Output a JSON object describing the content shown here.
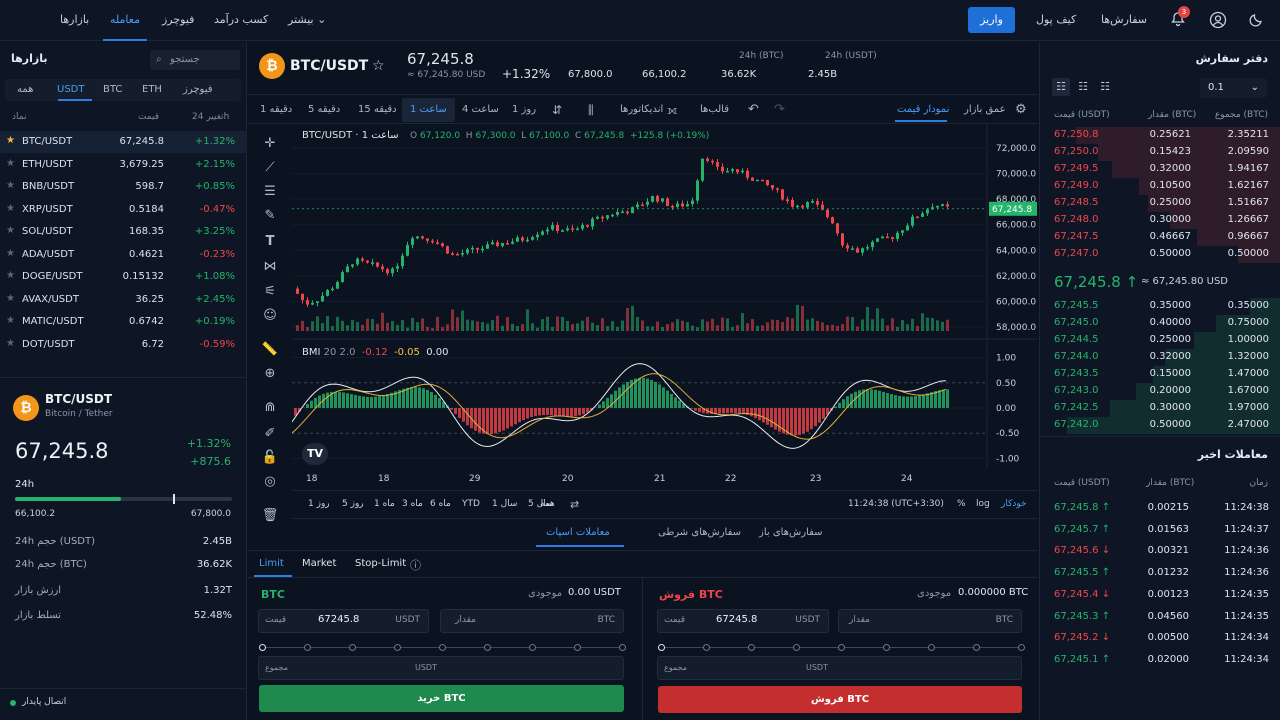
{
  "topbar": {
    "nav": [
      "بازارها",
      "فیوچرز",
      "معامله",
      "کسب درآمد",
      "بیشتر"
    ],
    "deposit": "واریز",
    "wallet": "کیف پول",
    "orders": "سفارش‌ها",
    "notif_count": "3"
  },
  "markets": {
    "title": "بازارها",
    "search_placeholder": "جستجو",
    "tabs": [
      "فیوچرز",
      "ETH",
      "BTC",
      "USDT",
      "همه"
    ],
    "col_name": "نماد",
    "col_price": "قیمت",
    "col_change": "تغییر 24h",
    "rows": [
      {
        "sym": "BTC/USDT",
        "price": "67,245.8",
        "change": "+1.32%",
        "up": true
      },
      {
        "sym": "ETH/USDT",
        "price": "3,679.25",
        "change": "+2.15%",
        "up": true
      },
      {
        "sym": "BNB/USDT",
        "price": "598.7",
        "change": "+0.85%",
        "up": true
      },
      {
        "sym": "XRP/USDT",
        "price": "0.5184",
        "change": "-0.47%",
        "up": false
      },
      {
        "sym": "SOL/USDT",
        "price": "168.35",
        "change": "+3.25%",
        "up": true
      },
      {
        "sym": "ADA/USDT",
        "price": "0.4621",
        "change": "-0.23%",
        "up": false
      },
      {
        "sym": "DOGE/USDT",
        "price": "0.15132",
        "change": "+1.08%",
        "up": true
      },
      {
        "sym": "AVAX/USDT",
        "price": "36.25",
        "change": "+2.45%",
        "up": true
      },
      {
        "sym": "MATIC/USDT",
        "price": "0.6742",
        "change": "+0.19%",
        "up": true
      },
      {
        "sym": "DOT/USDT",
        "price": "6.72",
        "change": "-0.59%",
        "up": false
      }
    ]
  },
  "summary": {
    "pair": "BTC/USDT",
    "sub": "Bitcoin / Tether",
    "price": "67,245.8",
    "chg_pct": "+1.32%",
    "chg_abs": "+875.6",
    "range_label": "24h",
    "low": "66,100.2",
    "high": "67,800.0",
    "range_fraction": 0.73,
    "stats": [
      {
        "k": "24h حجم (USDT)",
        "v": "2.45B"
      },
      {
        "k": "24h حجم (BTC)",
        "v": "36.62K"
      },
      {
        "k": "ارزش بازار",
        "v": "1.32T"
      },
      {
        "k": "تسلط بازار",
        "v": "52.48%"
      }
    ],
    "connection": "اتصال پایدار"
  },
  "header": {
    "pair": "BTC/USDT",
    "price": "67,245.8",
    "usd": "≈ 67,245.80 USD",
    "chg": "+1.32%",
    "high": "67,800.0",
    "low": "66,100.2",
    "vol_btc_label": "24h (BTC)",
    "vol_btc": "36.62K",
    "vol_usdt_label": "24h (USDT)",
    "vol_usdt": "2.45B"
  },
  "toolbar": {
    "intervals": [
      "1 دقیقه",
      "5 دقیقه",
      "15 دقیقه",
      "1 ساعت",
      "4 ساعت",
      "1 روز"
    ],
    "indicators": "اندیکاتورها",
    "templates": "قالب‌ها",
    "depth": "عمق بازار",
    "price_chart": "نمودار قیمت"
  },
  "chart": {
    "legend_sym": "BTC/USDT · 1 ساعت",
    "o": "67,120.0",
    "h": "67,300.0",
    "l": "67,100.0",
    "c": "67,245.8",
    "chg": "+125.8 (+0.19%)",
    "price_ticks": [
      "72,000.0",
      "70,000.0",
      "68,000.0",
      "66,000.0",
      "64,000.0",
      "62,000.0",
      "60,000.0",
      "58,000.0"
    ],
    "last_label": "67,245.8",
    "bmi_label": "BMI",
    "bmi_params": "20 2.0",
    "bmi_v1": "-0.12",
    "bmi_v2": "-0.05",
    "bmi_v3": "0.00",
    "bmi_ticks": [
      "1.00",
      "0.50",
      "0.00",
      "-0.50",
      "-1.00"
    ],
    "dates": [
      "18",
      "18",
      "29",
      "20",
      "21",
      "22",
      "23",
      "24"
    ],
    "ranges": [
      "1 روز",
      "5 روز",
      "1 ماه",
      "3 ماه",
      "6 ماه",
      "YTD",
      "1 سال",
      "5 سال",
      "همه"
    ],
    "time": "11:24:38 (UTC+3:30)",
    "pct": "%",
    "log": "log",
    "auto": "خودکار"
  },
  "chart_data": {
    "type": "candlestick",
    "y_axis": {
      "min": 58000,
      "max": 72000
    },
    "last_price": 67245.8,
    "dates": [
      "18",
      "18",
      "29",
      "20",
      "21",
      "22",
      "23",
      "24"
    ],
    "note_unit": "USDT"
  },
  "orders": {
    "bottom_tabs": [
      "سفارش‌های باز",
      "سفارش‌های شرطی",
      "معاملات اسپات"
    ],
    "types": [
      "Limit",
      "Market",
      "Stop-Limit"
    ],
    "buy": {
      "title": "BTC",
      "avail_label": "موجودی",
      "avail": "0.00 USDT",
      "price_label": "قیمت",
      "price": "67245.8",
      "unit": "USDT",
      "amount_label": "مقدار",
      "amount_unit": "BTC",
      "total_label": "مجموع",
      "total_unit": "USDT",
      "btn": "خرید BTC"
    },
    "sell": {
      "title": "فروش BTC",
      "avail_label": "موجودی",
      "avail": "0.000000 BTC",
      "price_label": "قیمت",
      "price": "67245.8",
      "unit": "USDT",
      "amount_label": "مقدار",
      "amount_unit": "BTC",
      "total_label": "مجموع",
      "total_unit": "USDT",
      "btn": "فروش BTC"
    }
  },
  "orderbook": {
    "title": "دفتر سفارش",
    "step": "0.1",
    "col_price": "قیمت (USDT)",
    "col_amount": "مقدار (BTC)",
    "col_total": "مجموع (BTC)",
    "asks": [
      {
        "p": "67,250.8",
        "q": "0.25621",
        "t": "2.35211",
        "d": 0.85
      },
      {
        "p": "67,250.0",
        "q": "0.15423",
        "t": "2.09590",
        "d": 0.76
      },
      {
        "p": "67,249.5",
        "q": "0.32000",
        "t": "1.94167",
        "d": 0.7
      },
      {
        "p": "67,249.0",
        "q": "0.10500",
        "t": "1.62167",
        "d": 0.59
      },
      {
        "p": "67,248.5",
        "q": "0.25000",
        "t": "1.51667",
        "d": 0.55
      },
      {
        "p": "67,248.0",
        "q": "0.30000",
        "t": "1.26667",
        "d": 0.46
      },
      {
        "p": "67,247.5",
        "q": "0.46667",
        "t": "0.96667",
        "d": 0.35
      },
      {
        "p": "67,247.0",
        "q": "0.50000",
        "t": "0.50000",
        "d": 0.18
      }
    ],
    "mid": "67,245.8 ↑",
    "mid_usd": "≈ 67,245.80 USD",
    "bids": [
      {
        "p": "67,245.5",
        "q": "0.35000",
        "t": "0.35000",
        "d": 0.13
      },
      {
        "p": "67,245.0",
        "q": "0.40000",
        "t": "0.75000",
        "d": 0.27
      },
      {
        "p": "67,244.5",
        "q": "0.25000",
        "t": "1.00000",
        "d": 0.36
      },
      {
        "p": "67,244.0",
        "q": "0.32000",
        "t": "1.32000",
        "d": 0.48
      },
      {
        "p": "67,243.5",
        "q": "0.15000",
        "t": "1.47000",
        "d": 0.53
      },
      {
        "p": "67,243.0",
        "q": "0.20000",
        "t": "1.67000",
        "d": 0.6
      },
      {
        "p": "67,242.5",
        "q": "0.30000",
        "t": "1.97000",
        "d": 0.71
      },
      {
        "p": "67,242.0",
        "q": "0.50000",
        "t": "2.47000",
        "d": 0.89
      }
    ]
  },
  "trades": {
    "title": "معاملات اخیر",
    "col_price": "قیمت (USDT)",
    "col_amount": "مقدار (BTC)",
    "col_time": "زمان",
    "rows": [
      {
        "p": "67,245.8 ↑",
        "q": "0.00215",
        "t": "11:24:38",
        "up": true
      },
      {
        "p": "67,245.7 ↑",
        "q": "0.01563",
        "t": "11:24:37",
        "up": true
      },
      {
        "p": "67,245.6 ↓",
        "q": "0.00321",
        "t": "11:24:36",
        "up": false
      },
      {
        "p": "67,245.5 ↑",
        "q": "0.01232",
        "t": "11:24:36",
        "up": true
      },
      {
        "p": "67,245.4 ↓",
        "q": "0.00123",
        "t": "11:24:35",
        "up": false
      },
      {
        "p": "67,245.3 ↑",
        "q": "0.04560",
        "t": "11:24:35",
        "up": true
      },
      {
        "p": "67,245.2 ↓",
        "q": "0.00500",
        "t": "11:24:34",
        "up": false
      },
      {
        "p": "67,245.1 ↑",
        "q": "0.02000",
        "t": "11:24:34",
        "up": true
      }
    ]
  },
  "colors": {
    "up": "#26b36b",
    "down": "#f0454a",
    "accent": "#2f7de1",
    "bg": "#0b1220"
  }
}
